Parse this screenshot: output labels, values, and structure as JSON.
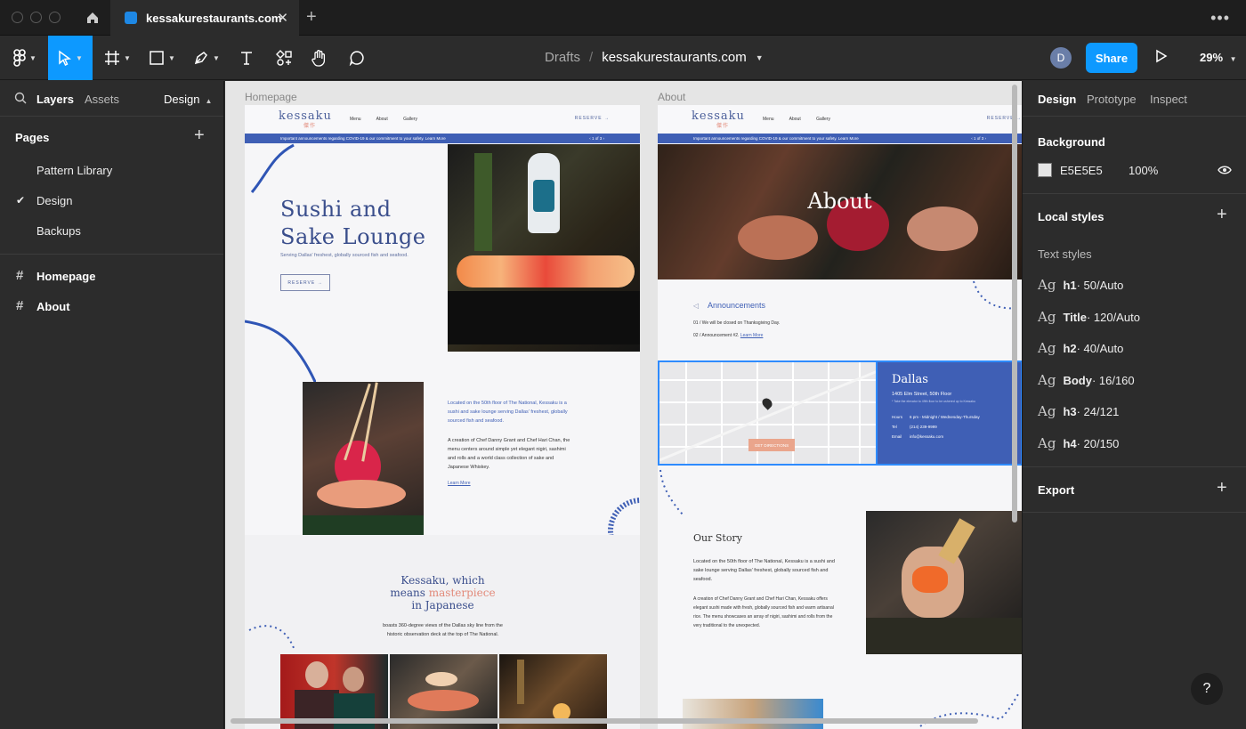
{
  "window": {
    "tab_title": "kessakurestaurants.com"
  },
  "toolbar": {
    "breadcrumb_root": "Drafts",
    "breadcrumb_sep": "/",
    "file_name": "kessakurestaurants.com",
    "avatar_initial": "D",
    "share_label": "Share",
    "zoom": "29%"
  },
  "left": {
    "tabs": {
      "layers": "Layers",
      "assets": "Assets",
      "design": "Design"
    },
    "pages_label": "Pages",
    "pages": [
      {
        "label": "Pattern Library",
        "selected": false
      },
      {
        "label": "Design",
        "selected": true
      },
      {
        "label": "Backups",
        "selected": false
      }
    ],
    "frames": [
      {
        "label": "Homepage"
      },
      {
        "label": "About"
      }
    ]
  },
  "canvas": {
    "frame_labels": {
      "homepage": "Homepage",
      "about": "About"
    },
    "site": {
      "logo": "kessaku",
      "logo_sub": "傑作",
      "nav": [
        "Menu",
        "About",
        "Gallery"
      ],
      "reserve": "RESERVE →",
      "banner": "Important announcements regarding COVID-19 & our commitment to your safety. Learn More",
      "banner_pager": "‹   1 of 3   ›"
    },
    "home": {
      "hero_line1": "Sushi and",
      "hero_line2": "Sake Lounge",
      "hero_sub": "Serving Dallas' freshest, globally sourced fish and seafood.",
      "reserve_btn": "RESERVE →",
      "intro_1": "Located on the 50th floor of The National, Kessaku is a sushi and sake lounge serving Dallas' freshest, globally sourced fish and seafood.",
      "intro_2": "A creation of Chef Danny Grant and Chef Hari Chan, the menu centers around simple yet elegant nigiri, sashimi and rolls and a world class collection of sake and Japanese Whiskey.",
      "learn_more": "Learn More",
      "masterpiece_1": "Kessaku, which",
      "masterpiece_2a": "means ",
      "masterpiece_2b": "masterpiece",
      "masterpiece_3": "in Japanese",
      "views_text": "boasts 360-degree views of the Dallas sky line from the historic observation deck at the top of The National."
    },
    "about": {
      "hero_title": "About",
      "announcements_title": "Announcements",
      "ann_1": "01 /   We will be closed on Thanksgiving Day.",
      "ann_2": "02 /   Announcement #2.",
      "ann_link": "Learn More",
      "city": "Dallas",
      "address": "1405 Elm Street, 50th Floor",
      "address_note": "* Take the elevator to 49th floor to be ushered up to Kessaku",
      "hours_label": "Hours",
      "hours": "6 pm - Midnight / Wednesday-Thursday",
      "tel_label": "Tel",
      "tel": "(214) 239-9999",
      "email_label": "Email",
      "email": "info@kessaku.com",
      "get_directions": "GET DIRECTIONS",
      "story_title": "Our Story",
      "story_1": "Located on the 50th floor of The National, Kessaku is a sushi and sake lounge serving Dallas' freshest, globally sourced fish and seafood.",
      "story_2": "A creation of Chef Danny Grant and Chef Hari Chan, Kessaku offers elegant sushi made with fresh, globally sourced fish and warm artisanal rice. The menu showcases an array of nigiri, sashimi and rolls from the very traditional to the unexpected."
    }
  },
  "right": {
    "tabs": {
      "design": "Design",
      "prototype": "Prototype",
      "inspect": "Inspect"
    },
    "background_label": "Background",
    "background_hex": "E5E5E5",
    "background_opacity": "100%",
    "local_styles": "Local styles",
    "text_styles": "Text styles",
    "styles": [
      {
        "name": "h1",
        "spec": " · 50/Auto"
      },
      {
        "name": "Title",
        "spec": " · 120/Auto"
      },
      {
        "name": "h2",
        "spec": " · 40/Auto"
      },
      {
        "name": "Body",
        "spec": " · 16/160"
      },
      {
        "name": "h3",
        "spec": " · 24/121"
      },
      {
        "name": "h4",
        "spec": " · 20/150"
      }
    ],
    "export_label": "Export"
  },
  "help_label": "?",
  "colors": {
    "accent": "#0d99ff",
    "brand_blue": "#3f5fb5",
    "canvas_bg": "#e5e5e5"
  }
}
